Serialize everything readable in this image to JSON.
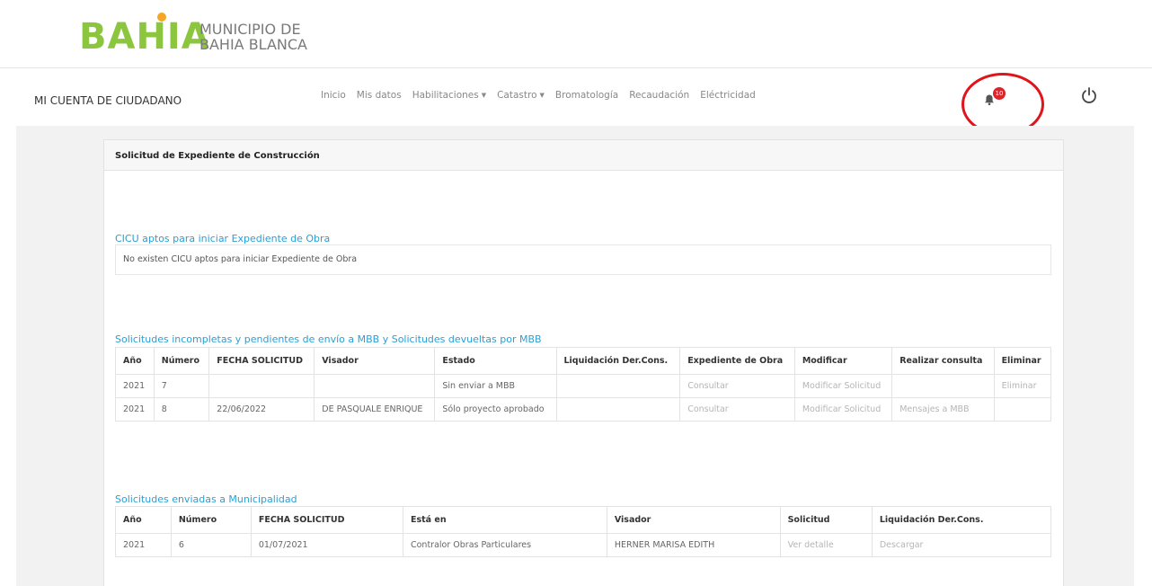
{
  "logo": {
    "word": "BAHIA",
    "subtitle_line1": "MUNICIPIO DE",
    "subtitle_line2": "BAHIA BLANCA"
  },
  "nav": {
    "brand": "MI CUENTA DE CIUDADANO",
    "links": [
      "Inicio",
      "Mis datos",
      "Habilitaciones",
      "Catastro",
      "Bromatología",
      "Recaudación",
      "Eléctricidad"
    ],
    "dropdown_links": [
      "Habilitaciones",
      "Catastro"
    ],
    "notification_count": "10",
    "icons": {
      "bell": "bell-icon",
      "power": "power-icon"
    }
  },
  "card": {
    "title": "Solicitud de Expediente de Construcción",
    "cicu": {
      "title": "CICU aptos para iniciar Expediente de Obra",
      "empty": "No existen CICU aptos para iniciar Expediente de Obra"
    },
    "pending": {
      "title": "Solicitudes incompletas y pendientes de envío a MBB y Solicitudes devueltas por MBB",
      "headers": [
        "Año",
        "Número",
        "FECHA SOLICITUD",
        "Visador",
        "Estado",
        "Liquidación Der.Cons.",
        "Expediente de Obra",
        "Modificar",
        "Realizar consulta",
        "Eliminar"
      ],
      "rows": [
        [
          "2021",
          "7",
          "",
          "",
          "Sin enviar a MBB",
          "",
          "Consultar",
          "Modificar Solicitud",
          "",
          "Eliminar"
        ],
        [
          "2021",
          "8",
          "22/06/2022",
          "DE PASQUALE ENRIQUE",
          "Sólo proyecto aprobado",
          "",
          "Consultar",
          "Modificar Solicitud",
          "Mensajes a MBB",
          ""
        ]
      ]
    },
    "sent": {
      "title": "Solicitudes enviadas a Municipalidad",
      "headers": [
        "Año",
        "Número",
        "FECHA SOLICITUD",
        "Está en",
        "Visador",
        "Solicitud",
        "Liquidación Der.Cons."
      ],
      "rows": [
        [
          "2021",
          "6",
          "01/07/2021",
          "Contralor Obras Particulares",
          "HERNER MARISA EDITH",
          "Ver detalle",
          "Descargar"
        ]
      ]
    }
  },
  "colors": {
    "brand_green": "#8cc63f",
    "link_blue": "#2a9fd6",
    "badge_red": "#d9262c",
    "highlight_circle": "#e0141b"
  }
}
